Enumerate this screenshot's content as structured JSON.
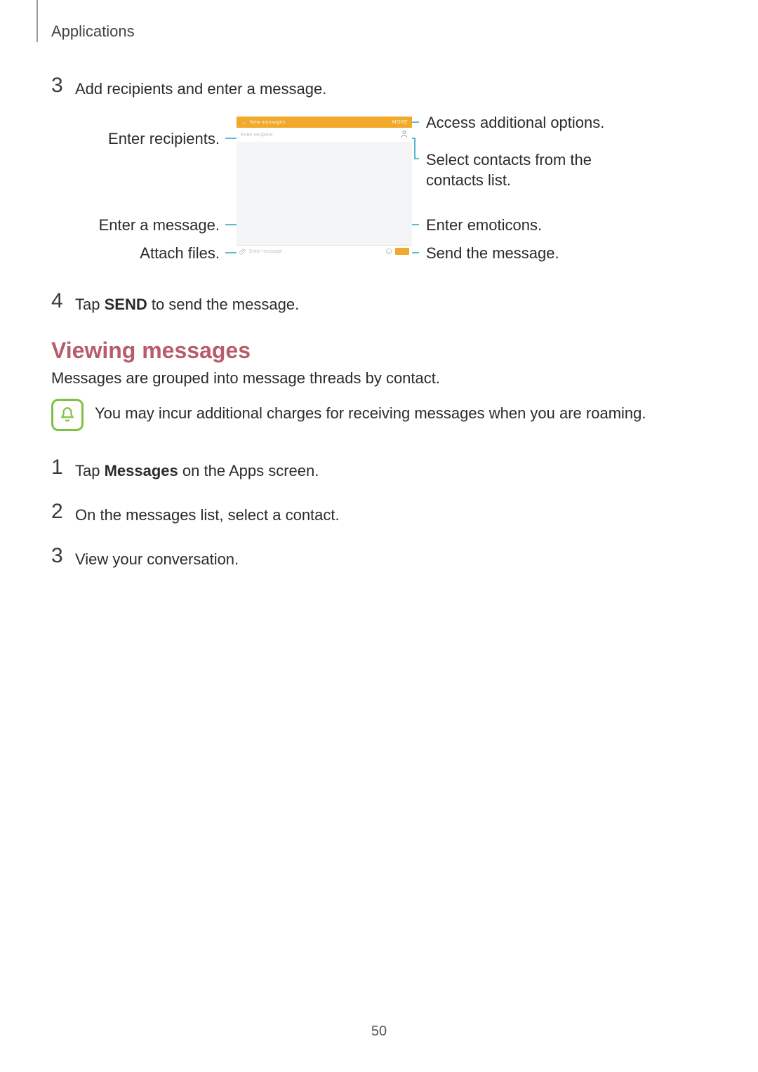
{
  "breadcrumb": "Applications",
  "stepA3": {
    "num": "3",
    "text": "Add recipients and enter a message."
  },
  "stepA4": {
    "num": "4",
    "pre": "Tap ",
    "bold": "SEND",
    "post": " to send the message."
  },
  "section_title": "Viewing messages",
  "intro": "Messages are grouped into message threads by contact.",
  "note": "You may incur additional charges for receiving messages when you are roaming.",
  "stepB1": {
    "num": "1",
    "pre": "Tap ",
    "bold": "Messages",
    "post": " on the Apps screen."
  },
  "stepB2": {
    "num": "2",
    "text": "On the messages list, select a contact."
  },
  "stepB3": {
    "num": "3",
    "text": "View your conversation."
  },
  "page_number": "50",
  "diagram": {
    "phone": {
      "header_title": "New messages",
      "header_more": "MORE",
      "recipient_placeholder": "Enter recipient",
      "composer_placeholder": "Enter message"
    },
    "callouts_left": {
      "recipients": "Enter recipients.",
      "message": "Enter a message.",
      "attach": "Attach files."
    },
    "callouts_right": {
      "options": "Access additional options.",
      "contacts": "Select contacts from the contacts list.",
      "emoticons": "Enter emoticons.",
      "send": "Send the message."
    }
  }
}
